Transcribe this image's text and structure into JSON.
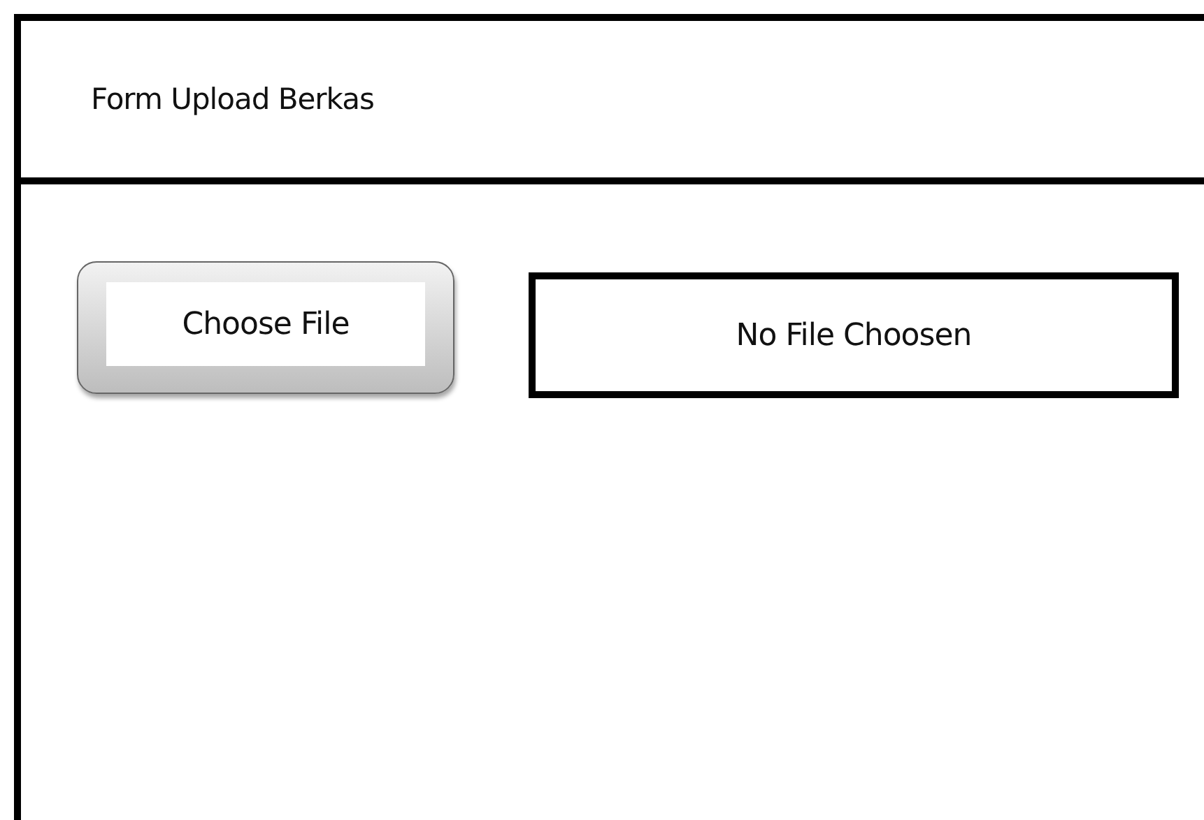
{
  "window": {
    "title": "Form Upload Berkas"
  },
  "file_input": {
    "button": "Choose File",
    "status": "No File Choosen"
  }
}
